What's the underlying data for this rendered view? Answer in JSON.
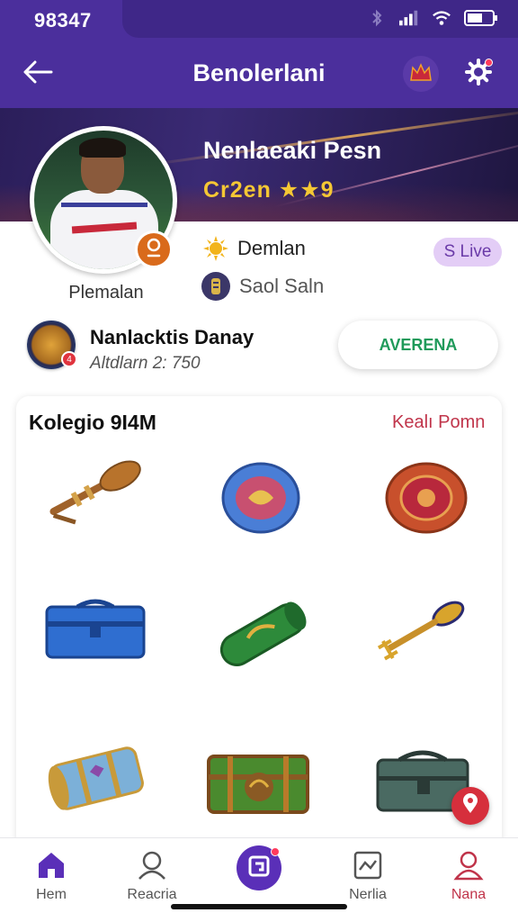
{
  "status_bar": {
    "time": "98347",
    "icons": [
      "bluetooth-icon",
      "signal-icon",
      "wifi-icon",
      "battery-icon"
    ]
  },
  "header": {
    "title": "Benolerlani",
    "back_icon": "back-arrow-icon",
    "crown_icon": "crown-icon",
    "settings_icon": "gear-icon"
  },
  "profile": {
    "banner_name": "Nenlaeaki Pesn",
    "banner_tag": "Cr2en ★★9",
    "avatar_label": "Plemalan",
    "stat_primary": "Demlan",
    "stat_secondary": "Saol Saln",
    "live_label": "S Live"
  },
  "team": {
    "name": "Nanlacktis Danay",
    "subtitle": "Altdlarn 2: 750",
    "follow_label": "AVERENA"
  },
  "collection": {
    "title": "Kolegio 9I4M",
    "link": "Kealı Pomn",
    "items": [
      "wooden-club-item",
      "blue-shield-item",
      "red-shield-item",
      "blue-chest-item",
      "green-scroll-item",
      "golden-staff-item",
      "drum-barrel-item",
      "green-treasure-chest-item",
      "metal-chest-item"
    ]
  },
  "bottom_nav": {
    "items": [
      {
        "label": "Hem",
        "icon": "home-icon"
      },
      {
        "label": "Reacria",
        "icon": "user-icon"
      },
      {
        "label": "",
        "icon": "center-action-icon"
      },
      {
        "label": "Nerlia",
        "icon": "message-icon"
      },
      {
        "label": "Nana",
        "icon": "profile-icon"
      }
    ]
  },
  "colors": {
    "primary": "#4b2f9c",
    "accent_gold": "#f5c734",
    "live_pill": "#e3cdf6",
    "follow_text": "#1f9a5a",
    "link_red": "#c0344a"
  }
}
